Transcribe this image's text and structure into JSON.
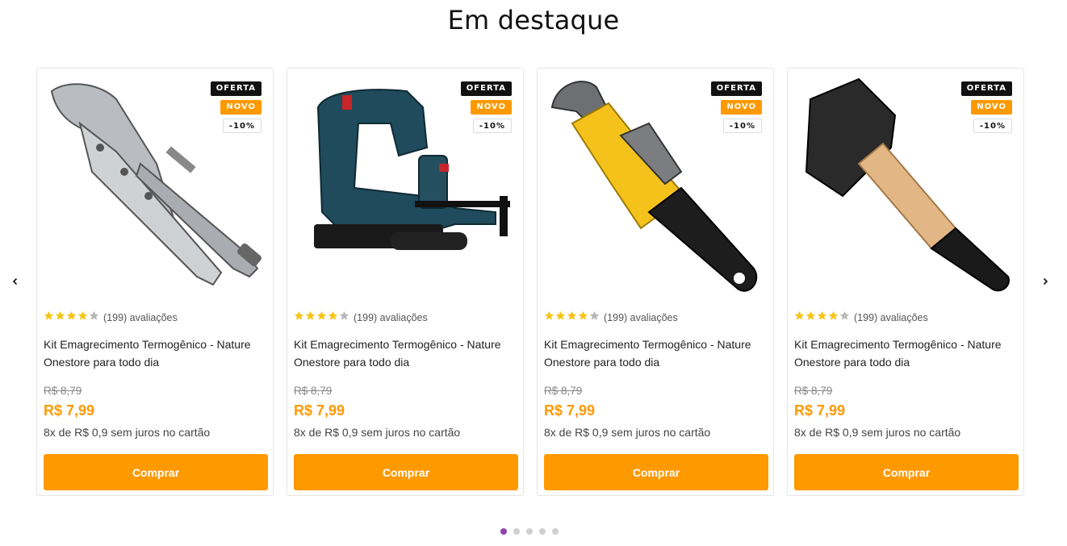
{
  "section": {
    "title": "Em destaque"
  },
  "colors": {
    "accent": "#ff9900",
    "badge_dark": "#111111",
    "dot_active": "#8e44ad",
    "star": "#f5c518"
  },
  "nav": {
    "prev_icon": "chevron-left-icon",
    "next_icon": "chevron-right-icon"
  },
  "products": [
    {
      "image": "locking-pliers",
      "badges": {
        "oferta": "OFERTA",
        "novo": "NOVO",
        "discount": "-10%"
      },
      "rating": {
        "stars": 4,
        "max": 5,
        "text": "(199) avaliações"
      },
      "name": "Kit Emagrecimento Termogênico  - Nature Onestore para todo dia",
      "old_price": "R$ 8,79",
      "price": "R$ 7,99",
      "installments": "8x de R$ 0,9 sem juros no cartão",
      "button": "Comprar"
    },
    {
      "image": "jigsaw",
      "badges": {
        "oferta": "OFERTA",
        "novo": "NOVO",
        "discount": "-10%"
      },
      "rating": {
        "stars": 4,
        "max": 5,
        "text": "(199) avaliações"
      },
      "name": "Kit Emagrecimento Termogênico  - Nature Onestore para todo dia",
      "old_price": "R$ 8,79",
      "price": "R$ 7,99",
      "installments": "8x de R$ 0,9 sem juros no cartão",
      "button": "Comprar"
    },
    {
      "image": "pipe-wrench",
      "badges": {
        "oferta": "OFERTA",
        "novo": "NOVO",
        "discount": "-10%"
      },
      "rating": {
        "stars": 4,
        "max": 5,
        "text": "(199) avaliações"
      },
      "name": "Kit Emagrecimento Termogênico  - Nature Onestore para todo dia",
      "old_price": "R$ 8,79",
      "price": "R$ 7,99",
      "installments": "8x de R$ 0,9 sem juros no cartão",
      "button": "Comprar"
    },
    {
      "image": "sledge-hammer",
      "badges": {
        "oferta": "OFERTA",
        "novo": "NOVO",
        "discount": "-10%"
      },
      "rating": {
        "stars": 4,
        "max": 5,
        "text": "(199) avaliações"
      },
      "name": "Kit Emagrecimento Termogênico  - Nature Onestore para todo dia",
      "old_price": "R$ 8,79",
      "price": "R$ 7,99",
      "installments": "8x de R$ 0,9 sem juros no cartão",
      "button": "Comprar"
    }
  ],
  "pagination": {
    "count": 5,
    "active": 1
  }
}
